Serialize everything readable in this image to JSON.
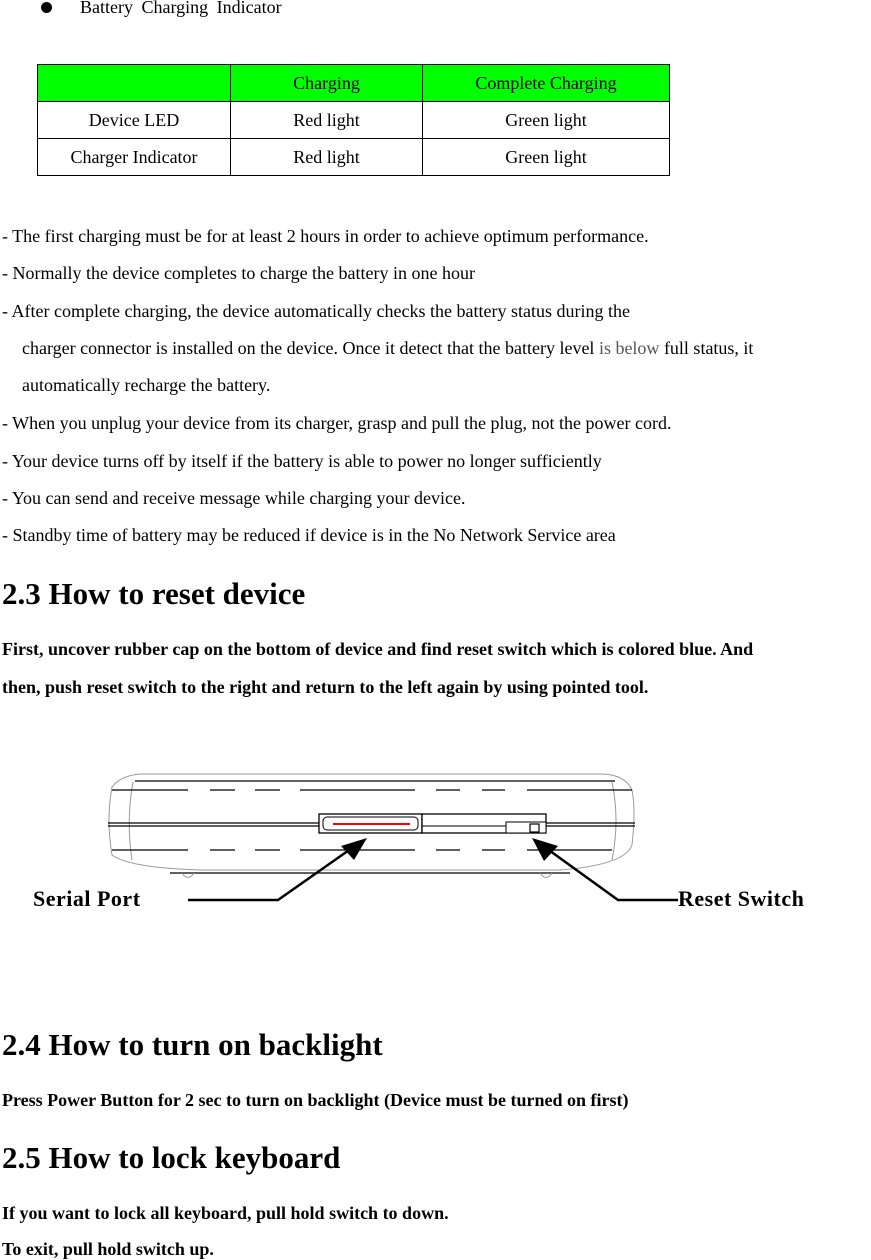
{
  "bullet": {
    "label": "Battery  Charging  Indicator"
  },
  "indicator_table": {
    "headers": [
      "",
      "Charging",
      "Complete Charging"
    ],
    "rows": [
      [
        "Device LED",
        "Red light",
        "Green light"
      ],
      [
        "Charger Indicator",
        "Red light",
        "Green light"
      ]
    ],
    "header_color": "#00ff00"
  },
  "notes": [
    "- The first charging must be for at least 2 hours in order to achieve optimum performance.",
    "- Normally the device completes to charge the battery in one hour",
    "- After complete charging, the device automatically checks the battery status during the",
    {
      "before": "charger connector is installed on the device. Once it detect that the battery level ",
      "highlight": "is below",
      "after": " full status, it"
    },
    "automatically recharge the battery.",
    "- When you unplug your device from its charger, grasp and pull the plug, not the power cord.",
    "- Your device turns off by itself if the battery is able to power no longer sufficiently",
    "- You can send and receive message while charging your device.",
    "- Standby time of battery may be reduced if device is in the No Network Service area"
  ],
  "section_reset": {
    "heading": "2.3 How to reset device",
    "lines": [
      "First, uncover rubber cap on the bottom of device and find reset switch which is colored blue. And",
      "then, push reset switch to the right and return to the left again by using pointed tool."
    ]
  },
  "diagram": {
    "serial_port_label": "Serial Port",
    "reset_switch_label": "Reset Switch",
    "serial_port_color": "#ff0000"
  },
  "section_backlight": {
    "heading": "2.4 How to turn on backlight",
    "text": "Press Power Button for 2 sec to turn on backlight (Device must be turned on first)"
  },
  "section_lock": {
    "heading": "2.5 How to lock keyboard",
    "lines": [
      "If you want to lock all keyboard, pull hold switch to down.",
      "To exit, pull hold switch up."
    ]
  }
}
